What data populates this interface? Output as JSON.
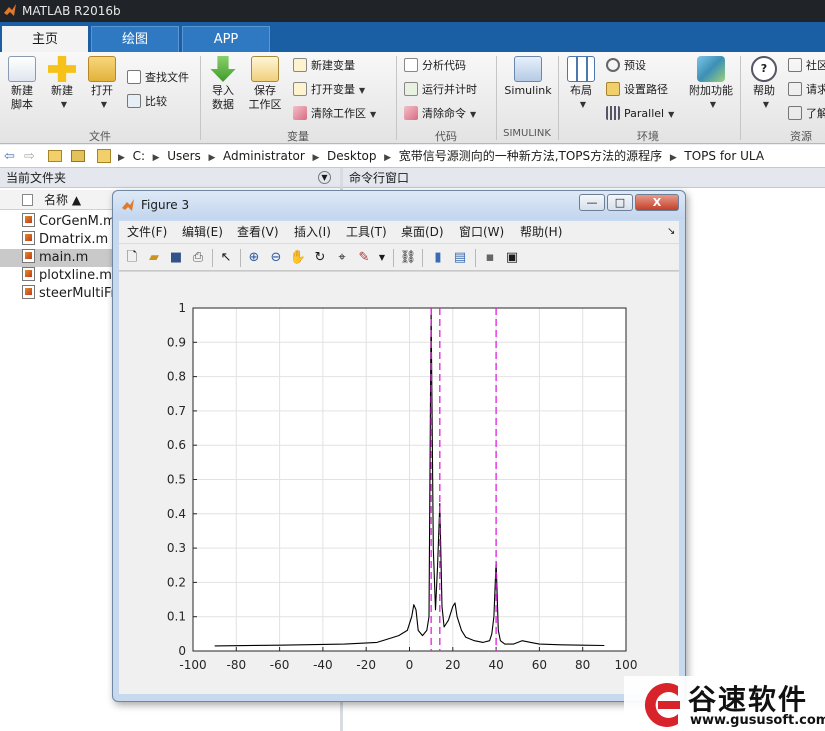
{
  "app": {
    "title": "MATLAB R2016b"
  },
  "tabs": [
    {
      "label": "主页"
    },
    {
      "label": "绘图"
    },
    {
      "label": "APP"
    }
  ],
  "ribbon": {
    "file": {
      "new_script": "新建\n脚本",
      "new": "新建",
      "open": "打开",
      "find_files": "查找文件",
      "compare": "比较",
      "group": "文件"
    },
    "variable": {
      "import": "导入\n数据",
      "save_ws": "保存\n工作区",
      "new_var": "新建变量",
      "open_var": "打开变量",
      "clear_ws": "清除工作区",
      "group": "变量"
    },
    "code": {
      "analyze": "分析代码",
      "run_time": "运行并计时",
      "clear_cmd": "清除命令",
      "group": "代码"
    },
    "simulink": {
      "label": "Simulink",
      "group": "SIMULINK"
    },
    "env": {
      "layout": "布局",
      "prefs": "预设",
      "set_path": "设置路径",
      "parallel": "Parallel",
      "addons": "附加功能",
      "group": "环境"
    },
    "resources": {
      "help": "帮助",
      "community": "社区",
      "request": "请求",
      "learn": "了解",
      "group": "资源"
    }
  },
  "address": {
    "crumbs": [
      "C:",
      "Users",
      "Administrator",
      "Desktop",
      "宽带信号源测向的一种新方法,TOPS方法的源程序",
      "TOPS for ULA"
    ]
  },
  "panels": {
    "current_folder": "当前文件夹",
    "command_window": "命令行窗口",
    "name_col": "名称 ▲"
  },
  "files": [
    {
      "name": "CorGenM.m",
      "selected": false
    },
    {
      "name": "Dmatrix.m",
      "selected": false
    },
    {
      "name": "main.m",
      "selected": true
    },
    {
      "name": "plotxline.m",
      "selected": false
    },
    {
      "name": "steerMultiFr",
      "selected": false
    }
  ],
  "figure": {
    "title": "Figure 3",
    "menu": [
      "文件(F)",
      "编辑(E)",
      "查看(V)",
      "插入(I)",
      "工具(T)",
      "桌面(D)",
      "窗口(W)",
      "帮助(H)"
    ],
    "buttons": {
      "minimize": "—",
      "maximize": "□",
      "close": "X"
    }
  },
  "chart_data": {
    "type": "line",
    "title": "",
    "xlabel": "",
    "ylabel": "",
    "xlim": [
      -100,
      100
    ],
    "ylim": [
      0,
      1
    ],
    "xticks": [
      -100,
      -80,
      -60,
      -40,
      -20,
      0,
      20,
      40,
      60,
      80,
      100
    ],
    "yticks": [
      0,
      0.1,
      0.2,
      0.3,
      0.4,
      0.5,
      0.6,
      0.7,
      0.8,
      0.9,
      1
    ],
    "grid": true,
    "series": [
      {
        "style": "solid",
        "color": "#000000",
        "x": [
          -90,
          -60,
          -30,
          -15,
          -10,
          -5,
          -1,
          1,
          2,
          3,
          4,
          6,
          8,
          9,
          10,
          11,
          12,
          13,
          14,
          15,
          16,
          18,
          20,
          21,
          22,
          24,
          26,
          30,
          34,
          37,
          38,
          39,
          40,
          41,
          42,
          44,
          48,
          52,
          56,
          60,
          70,
          80,
          90
        ],
        "y": [
          0.015,
          0.017,
          0.02,
          0.025,
          0.035,
          0.045,
          0.06,
          0.1,
          0.135,
          0.12,
          0.06,
          0.045,
          0.06,
          0.1,
          1.0,
          0.3,
          0.12,
          0.25,
          0.43,
          0.13,
          0.07,
          0.09,
          0.13,
          0.14,
          0.1,
          0.06,
          0.04,
          0.03,
          0.025,
          0.03,
          0.05,
          0.1,
          0.26,
          0.06,
          0.03,
          0.02,
          0.02,
          0.03,
          0.025,
          0.02,
          0.018,
          0.017,
          0.016
        ]
      },
      {
        "style": "dashed",
        "color": "#e020e0",
        "x_lines": [
          10,
          14,
          40
        ]
      }
    ]
  },
  "watermark": {
    "brand": "谷速软件",
    "url": "www.gususoft.com"
  },
  "colors": {
    "ribbon_blue": "#1a5fa3",
    "marker_magenta": "#e020e0"
  }
}
